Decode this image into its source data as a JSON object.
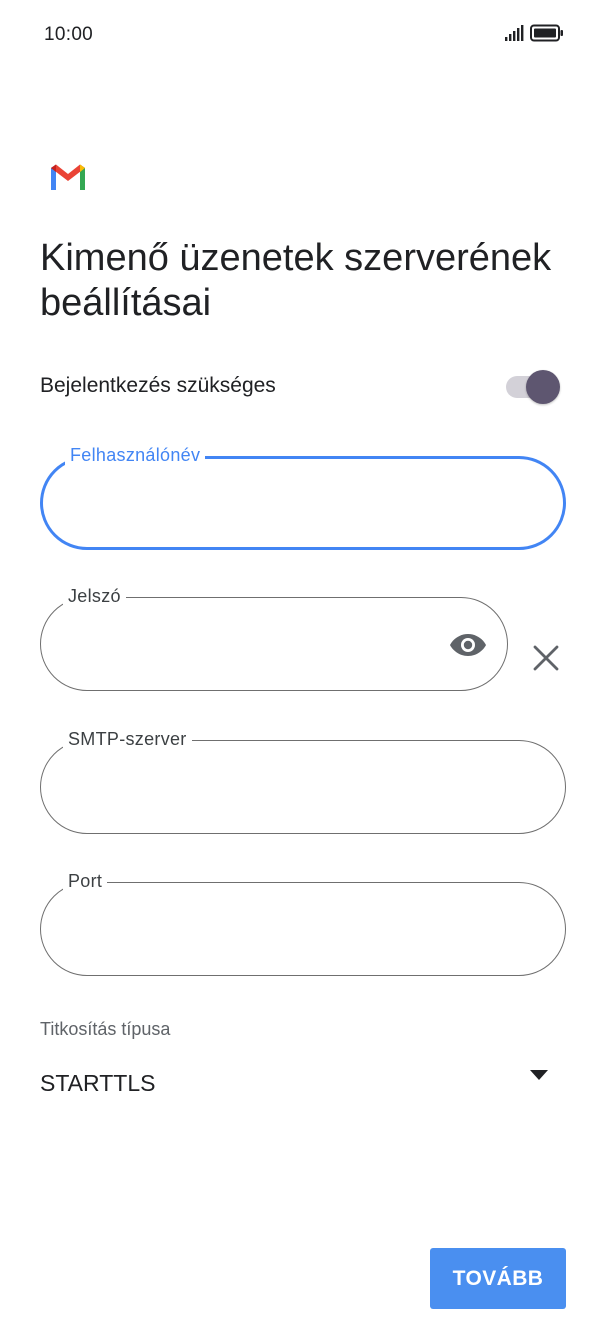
{
  "status_bar": {
    "time": "10:00",
    "icons": [
      "signal-icon",
      "battery-icon"
    ]
  },
  "app": {
    "logo": "gmail-logo",
    "title": "Kimenő üzenetek szerverének beállításai"
  },
  "login_required": {
    "label": "Bejelentkezés szükséges",
    "enabled": true
  },
  "fields": {
    "username": {
      "label": "Felhasználónév",
      "value": "",
      "focused": true
    },
    "password": {
      "label": "Jelszó",
      "value": "",
      "icons": [
        "eye-icon",
        "close-icon"
      ]
    },
    "smtp_server": {
      "label": "SMTP-szerver",
      "value": ""
    },
    "port": {
      "label": "Port",
      "value": ""
    }
  },
  "encryption": {
    "label": "Titkosítás típusa",
    "selected": "STARTTLS"
  },
  "actions": {
    "next_label": "TOVÁBB"
  },
  "colors": {
    "accent": "#4285f4",
    "button": "#4a8ff0",
    "toggle_thumb": "#5e5670",
    "toggle_track": "#d3d1d8",
    "field_border": "#6f6f6f"
  }
}
